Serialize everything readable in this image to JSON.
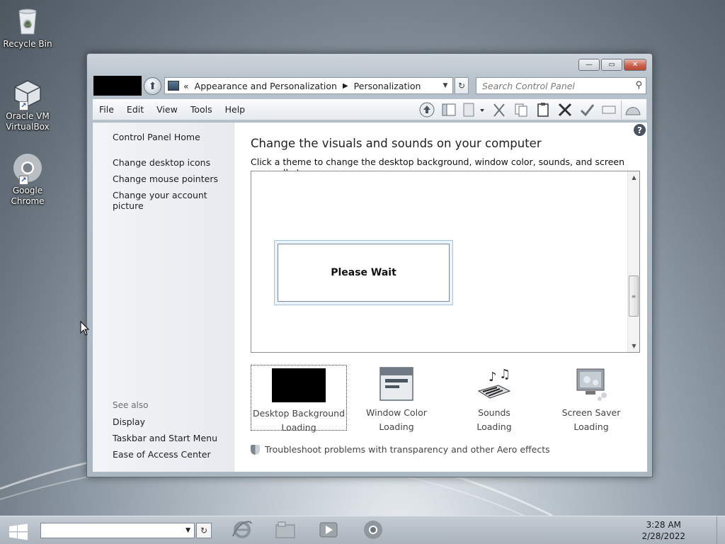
{
  "desktop": {
    "icons": [
      {
        "label": "Recycle Bin"
      },
      {
        "label": "Oracle VM VirtualBox"
      },
      {
        "label": "Google Chrome"
      }
    ]
  },
  "window": {
    "controls": {
      "minimize": "—",
      "maximize": "▭",
      "close": "✕"
    },
    "address": {
      "prefix": "«",
      "crumbs": [
        "Appearance and Personalization",
        "Personalization"
      ]
    },
    "search": {
      "placeholder": "Search Control Panel"
    },
    "menu": [
      "File",
      "Edit",
      "View",
      "Tools",
      "Help"
    ],
    "toolbar_icons": [
      "up-icon",
      "preview-pane-icon",
      "properties-icon",
      "cut-icon",
      "copy-icon",
      "paste-icon",
      "delete-icon",
      "check-icon",
      "rename-icon",
      "shell-icon"
    ]
  },
  "sidebar": {
    "home": "Control Panel Home",
    "links": [
      "Change desktop icons",
      "Change mouse pointers",
      "Change your account picture"
    ],
    "see_also_title": "See also",
    "see_also": [
      "Display",
      "Taskbar and Start Menu",
      "Ease of Access Center"
    ]
  },
  "main": {
    "title": "Change the visuals and sounds on your computer",
    "subtitle": "Click a theme to change the desktop background, window color, sounds, and screen saver all at once.",
    "wait_text": "Please Wait",
    "options": [
      {
        "label": "Desktop Background",
        "status": "Loading"
      },
      {
        "label": "Window Color",
        "status": "Loading"
      },
      {
        "label": "Sounds",
        "status": "Loading"
      },
      {
        "label": "Screen Saver",
        "status": "Loading"
      }
    ],
    "troubleshoot": "Troubleshoot problems with transparency and other Aero effects"
  },
  "taskbar": {
    "clock_time": "3:28 AM",
    "clock_date": "2/28/2022"
  },
  "colors": {
    "accent": "#1e3a5f",
    "close": "#c95d46"
  }
}
